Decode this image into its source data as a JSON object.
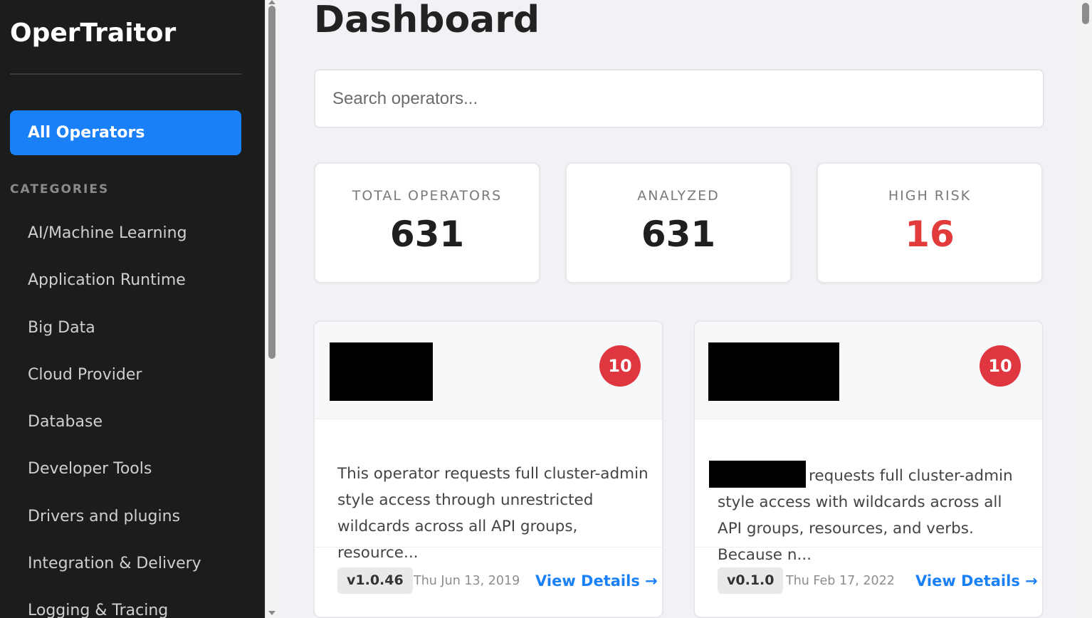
{
  "app": {
    "name": "OperTraitor"
  },
  "sidebar": {
    "all_operators_label": "All Operators",
    "categories_title": "CATEGORIES",
    "items": [
      {
        "label": "AI/Machine Learning"
      },
      {
        "label": "Application Runtime"
      },
      {
        "label": "Big Data"
      },
      {
        "label": "Cloud Provider"
      },
      {
        "label": "Database"
      },
      {
        "label": "Developer Tools"
      },
      {
        "label": "Drivers and plugins"
      },
      {
        "label": "Integration & Delivery"
      },
      {
        "label": "Logging & Tracing"
      }
    ]
  },
  "main": {
    "title": "Dashboard",
    "search": {
      "placeholder": "Search operators...",
      "value": ""
    },
    "stats": [
      {
        "label": "TOTAL OPERATORS",
        "value": "631"
      },
      {
        "label": "ANALYZED",
        "value": "631"
      },
      {
        "label": "HIGH RISK",
        "value": "16"
      }
    ],
    "cards": [
      {
        "risk_score": "10",
        "description": "This operator requests full cluster-admin style access through unrestricted wildcards across all API groups, resource...",
        "version": "v1.0.46",
        "date": "Thu Jun 13, 2019",
        "link_label": "View Details →"
      },
      {
        "risk_score": "10",
        "description": "requests full cluster-admin style access with wildcards across all API groups, resources, and verbs. Because n...",
        "version": "v0.1.0",
        "date": "Thu Feb 17, 2022",
        "link_label": "View Details →"
      }
    ]
  },
  "colors": {
    "accent": "#1a80f7",
    "sidebar_bg": "#1c1c1c",
    "risk": "#e0363f"
  }
}
